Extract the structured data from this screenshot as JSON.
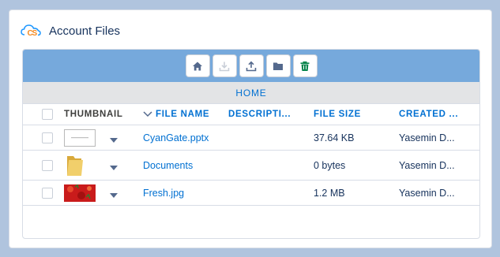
{
  "card": {
    "title": "Account Files",
    "logo_text": "CS"
  },
  "toolbar": {
    "buttons": [
      {
        "icon": "home-icon",
        "enabled": true
      },
      {
        "icon": "download-icon",
        "enabled": false
      },
      {
        "icon": "upload-icon",
        "enabled": true
      },
      {
        "icon": "folder-icon",
        "enabled": true
      },
      {
        "icon": "trash-icon",
        "enabled": true
      }
    ]
  },
  "breadcrumb": {
    "label": "HOME"
  },
  "table": {
    "columns": {
      "thumbnail": "THUMBNAIL",
      "file_name": "FILE NAME",
      "description": "DESCRIPTI...",
      "file_size": "FILE SIZE",
      "created": "CREATED ..."
    },
    "rows": [
      {
        "name": "CyanGate.pptx",
        "size": "37.64 KB",
        "created_by": "Yasemin D...",
        "thumb": "pptx"
      },
      {
        "name": "Documents",
        "size": "0 bytes",
        "created_by": "Yasemin D...",
        "thumb": "folder"
      },
      {
        "name": "Fresh.jpg",
        "size": "1.2 MB",
        "created_by": "Yasemin D...",
        "thumb": "image"
      }
    ]
  },
  "colors": {
    "toolbar_bg": "#76a9dc",
    "link": "#0070d2",
    "trash_green": "#04844b",
    "page_bg": "#b0c4de"
  }
}
